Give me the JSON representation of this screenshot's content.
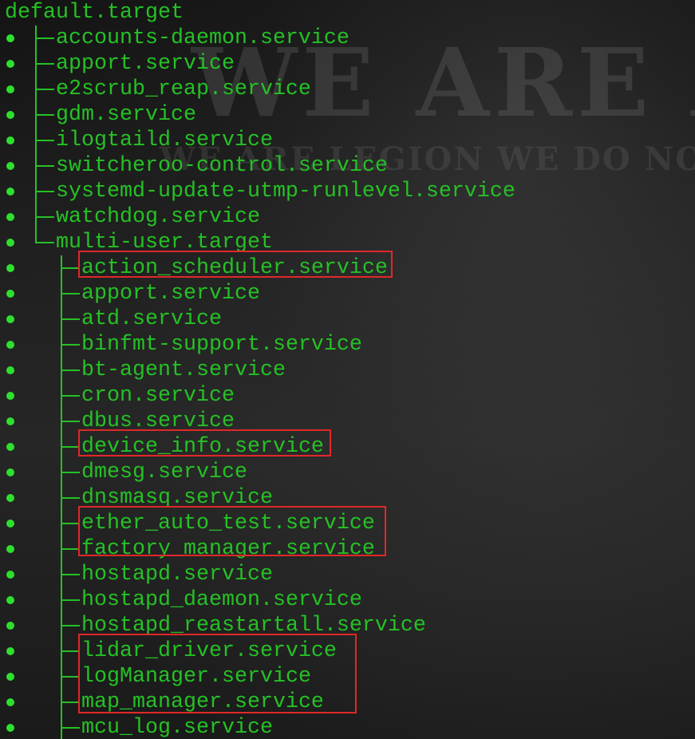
{
  "root_target": "default.target",
  "level1_services": [
    "accounts-daemon.service",
    "apport.service",
    "e2scrub_reap.service",
    "gdm.service",
    "ilogtaild.service",
    "switcheroo-control.service",
    "systemd-update-utmp-runlevel.service",
    "watchdog.service"
  ],
  "level1_target": "multi-user.target",
  "level2_services": [
    "action_scheduler.service",
    "apport.service",
    "atd.service",
    "binfmt-support.service",
    "bt-agent.service",
    "cron.service",
    "dbus.service",
    "device_info.service",
    "dmesg.service",
    "dnsmasq.service",
    "ether_auto_test.service",
    "factory_manager.service",
    "hostapd.service",
    "hostapd_daemon.service",
    "hostapd_reastartall.service",
    "lidar_driver.service",
    "logManager.service",
    "map_manager.service",
    "mcu_log.service"
  ],
  "highlight_color": "#e02828",
  "text_color": "#25c125",
  "bullet_color": "#2ee02e",
  "wallpaper": {
    "headline": "WE ARE A",
    "tagline": "WE ARE LEGION WE DO NOT FO"
  }
}
